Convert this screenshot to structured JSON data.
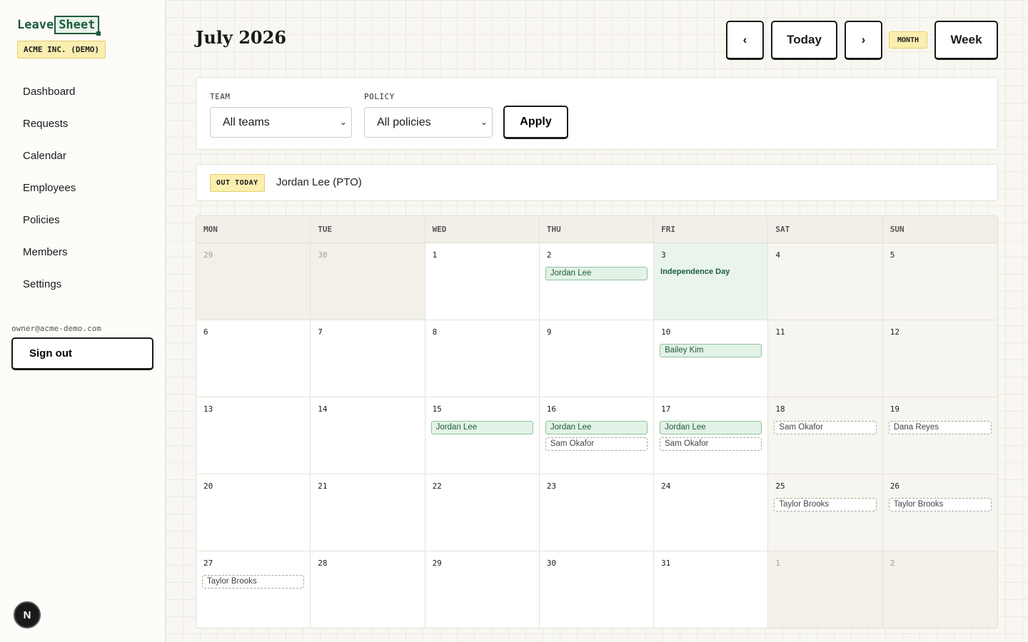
{
  "app": {
    "logo_part1": "Leave",
    "logo_part2": "Sheet",
    "org_name": "ACME INC. (DEMO)"
  },
  "sidebar": {
    "items": [
      {
        "label": "Dashboard"
      },
      {
        "label": "Requests"
      },
      {
        "label": "Calendar"
      },
      {
        "label": "Employees"
      },
      {
        "label": "Policies"
      },
      {
        "label": "Members"
      },
      {
        "label": "Settings"
      }
    ],
    "user_email": "owner@acme-demo.com",
    "sign_out_label": "Sign out",
    "dev_badge": "N"
  },
  "header": {
    "title": "July 2026",
    "prev_label": "‹",
    "today_label": "Today",
    "next_label": "›",
    "view_month_label": "MONTH",
    "view_week_label": "Week"
  },
  "filters": {
    "team_label": "TEAM",
    "team_value": "All teams",
    "policy_label": "POLICY",
    "policy_value": "All policies",
    "apply_label": "Apply"
  },
  "out_today": {
    "badge": "OUT TODAY",
    "text": "Jordan Lee (PTO)"
  },
  "calendar": {
    "weekdays": [
      "MON",
      "TUE",
      "WED",
      "THU",
      "FRI",
      "SAT",
      "SUN"
    ],
    "weeks": [
      [
        {
          "day": "29",
          "outside": true,
          "events": []
        },
        {
          "day": "30",
          "outside": true,
          "events": []
        },
        {
          "day": "1",
          "events": []
        },
        {
          "day": "2",
          "events": [
            {
              "name": "Jordan Lee",
              "status": "approved"
            }
          ]
        },
        {
          "day": "3",
          "holiday": "Independence Day",
          "events": []
        },
        {
          "day": "4",
          "weekend": true,
          "events": []
        },
        {
          "day": "5",
          "weekend": true,
          "events": []
        }
      ],
      [
        {
          "day": "6",
          "events": []
        },
        {
          "day": "7",
          "events": []
        },
        {
          "day": "8",
          "events": []
        },
        {
          "day": "9",
          "events": []
        },
        {
          "day": "10",
          "events": [
            {
              "name": "Bailey Kim",
              "status": "approved"
            }
          ]
        },
        {
          "day": "11",
          "weekend": true,
          "events": []
        },
        {
          "day": "12",
          "weekend": true,
          "events": []
        }
      ],
      [
        {
          "day": "13",
          "events": []
        },
        {
          "day": "14",
          "events": []
        },
        {
          "day": "15",
          "events": [
            {
              "name": "Jordan Lee",
              "status": "approved"
            }
          ]
        },
        {
          "day": "16",
          "events": [
            {
              "name": "Jordan Lee",
              "status": "approved"
            },
            {
              "name": "Sam Okafor",
              "status": "pending"
            }
          ]
        },
        {
          "day": "17",
          "events": [
            {
              "name": "Jordan Lee",
              "status": "approved"
            },
            {
              "name": "Sam Okafor",
              "status": "pending"
            }
          ]
        },
        {
          "day": "18",
          "weekend": true,
          "events": [
            {
              "name": "Sam Okafor",
              "status": "pending"
            }
          ]
        },
        {
          "day": "19",
          "weekend": true,
          "events": [
            {
              "name": "Dana Reyes",
              "status": "pending"
            }
          ]
        }
      ],
      [
        {
          "day": "20",
          "events": []
        },
        {
          "day": "21",
          "events": []
        },
        {
          "day": "22",
          "events": []
        },
        {
          "day": "23",
          "events": []
        },
        {
          "day": "24",
          "events": []
        },
        {
          "day": "25",
          "weekend": true,
          "events": [
            {
              "name": "Taylor Brooks",
              "status": "pending"
            }
          ]
        },
        {
          "day": "26",
          "weekend": true,
          "events": [
            {
              "name": "Taylor Brooks",
              "status": "pending"
            }
          ]
        }
      ],
      [
        {
          "day": "27",
          "events": [
            {
              "name": "Taylor Brooks",
              "status": "pending"
            }
          ]
        },
        {
          "day": "28",
          "events": []
        },
        {
          "day": "29",
          "events": []
        },
        {
          "day": "30",
          "events": []
        },
        {
          "day": "31",
          "events": []
        },
        {
          "day": "1",
          "outside": true,
          "events": []
        },
        {
          "day": "2",
          "outside": true,
          "events": []
        }
      ]
    ]
  },
  "colors": {
    "brand_green": "#1d5c3a",
    "badge_yellow": "#faeeb0",
    "approved_bg": "#e3f2e6",
    "holiday_bg": "#e9f4ec"
  }
}
